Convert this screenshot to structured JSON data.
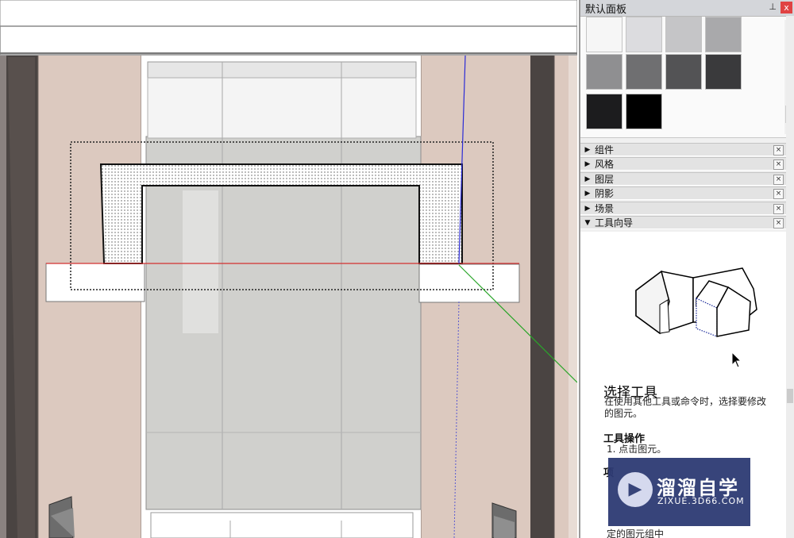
{
  "panel": {
    "title": "默认面板",
    "pin_icon": "pin-icon",
    "close_symbol": "x",
    "swatches": [
      "#f6f6f6",
      "#dcdcdf",
      "#c5c5c7",
      "#a9a9ab",
      "#8f8f91",
      "#6f6f71",
      "#535355",
      "#3a3a3c",
      "#1c1c1e",
      "#000000"
    ],
    "trays": [
      {
        "label": "组件",
        "expanded": false
      },
      {
        "label": "风格",
        "expanded": false
      },
      {
        "label": "图层",
        "expanded": false
      },
      {
        "label": "阴影",
        "expanded": false
      },
      {
        "label": "场景",
        "expanded": false
      },
      {
        "label": "工具向导",
        "expanded": true
      }
    ],
    "tray_close_symbol": "×"
  },
  "instructor": {
    "title": "选择工具",
    "description": "在使用其他工具或命令时，选择要修改的图元。",
    "operations_heading": "工具操作",
    "step1": "1. 点击图元。",
    "more_heading": "项",
    "tail_text": "定的图元组中"
  },
  "watermark": {
    "logo_icon": "play-icon",
    "brand": "溜溜自学",
    "site": "ZIXUE.3D66.COM"
  },
  "colors": {
    "wall": "#dcc9bf",
    "glass": "#cfcfcd",
    "dark_post": "#4a4442",
    "red_axis": "#d23030",
    "green_axis": "#2aa52a",
    "blue_axis": "#2b2bd6"
  }
}
